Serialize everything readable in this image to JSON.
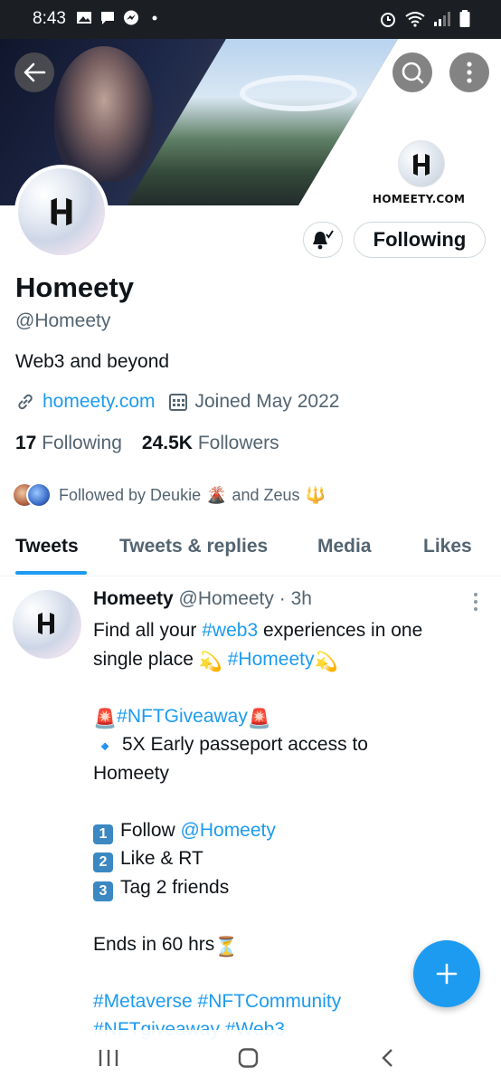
{
  "status_bar": {
    "time": "8:43"
  },
  "banner": {
    "brand_text": "HOMEETY.COM"
  },
  "profile": {
    "display_name": "Homeety",
    "handle": "@Homeety",
    "bio": "Web3 and beyond",
    "website": "homeety.com",
    "joined": "Joined May 2022",
    "following_count": "17",
    "following_label": "Following",
    "followers_count": "24.5K",
    "followers_label": "Followers",
    "followed_by_prefix": "Followed by Deukie",
    "followed_by_emoji1": "🌋",
    "followed_by_mid": "and Zeus",
    "followed_by_emoji2": "🔱",
    "follow_button_label": "Following"
  },
  "tabs": [
    {
      "label": "Tweets",
      "active": true
    },
    {
      "label": "Tweets & replies",
      "active": false
    },
    {
      "label": "Media",
      "active": false
    },
    {
      "label": "Likes",
      "active": false
    }
  ],
  "tweet": {
    "author_name": "Homeety",
    "author_handle": "@Homeety",
    "time_sep": "·",
    "time": "3h",
    "l1": "Find all your",
    "l1_tag": "#web3",
    "l1_end": "experiences in one",
    "l2": "single place",
    "l2_emoji": "💫",
    "l2_tag": "#Homeety",
    "l2_emoji2": "💫",
    "l3_emoji": "🚨",
    "l3_tag": "#NFTGiveaway",
    "l3_emoji2": "🚨",
    "l4_emoji": "🔹",
    "l4": "5X Early passeport access to",
    "l5": "Homeety",
    "s1_num": "1",
    "s1": "Follow",
    "s1_mention": "@Homeety",
    "s2_num": "2",
    "s2": "Like & RT",
    "s3_num": "3",
    "s3": "Tag 2 friends",
    "l6": "Ends in 60 hrs",
    "l6_emoji": "⏳",
    "tags1": "#Metaverse #NFTCommunity",
    "tags2": "#NFTgiveaway  #Web3"
  },
  "icons": {
    "back": "back-arrow-icon",
    "search": "search-icon",
    "more": "more-vertical-icon",
    "bell": "notification-bell-icon",
    "link": "link-icon",
    "calendar": "calendar-icon",
    "compose": "compose-plus-icon"
  },
  "colors": {
    "accent": "#1d9bf0",
    "secondary_text": "#536471",
    "status_bar": "#1b1f24"
  }
}
